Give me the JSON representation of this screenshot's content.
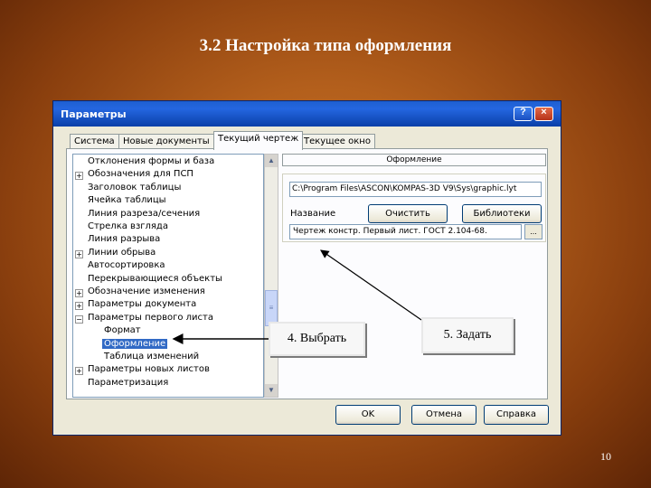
{
  "slide": {
    "title": "3.2 Настройка типа оформления",
    "number": "10"
  },
  "dialog": {
    "title": "Параметры",
    "titlebar_buttons": [
      "?",
      "×"
    ],
    "tabs": [
      "Система",
      "Новые документы",
      "Текущий чертеж",
      "Текущее окно"
    ],
    "active_tab": "Текущий чертеж",
    "tree": [
      {
        "label": "Отклонения формы и база",
        "expander": "",
        "indent": 0
      },
      {
        "label": "Обозначения для ПСП",
        "expander": "+",
        "indent": 0
      },
      {
        "label": "Заголовок таблицы",
        "expander": "",
        "indent": 0
      },
      {
        "label": "Ячейка таблицы",
        "expander": "",
        "indent": 0
      },
      {
        "label": "Линия разреза/сечения",
        "expander": "",
        "indent": 0
      },
      {
        "label": "Стрелка взгляда",
        "expander": "",
        "indent": 0
      },
      {
        "label": "Линия разрыва",
        "expander": "",
        "indent": 0
      },
      {
        "label": "Линии обрыва",
        "expander": "+",
        "indent": 0
      },
      {
        "label": "Автосортировка",
        "expander": "",
        "indent": 0
      },
      {
        "label": "Перекрывающиеся объекты",
        "expander": "",
        "indent": 0
      },
      {
        "label": "Обозначение изменения",
        "expander": "+",
        "indent": 0
      },
      {
        "label": "Параметры документа",
        "expander": "+",
        "indent": 0
      },
      {
        "label": "Параметры первого листа",
        "expander": "−",
        "indent": 0
      },
      {
        "label": "Формат",
        "expander": "",
        "indent": 1
      },
      {
        "label": "Оформление",
        "expander": "",
        "indent": 1,
        "selected": true
      },
      {
        "label": "Таблица изменений",
        "expander": "",
        "indent": 1
      },
      {
        "label": "Параметры новых листов",
        "expander": "+",
        "indent": 0
      },
      {
        "label": "Параметризация",
        "expander": "",
        "indent": 0
      }
    ],
    "scrollbar": {
      "up": "▲",
      "down": "▼",
      "grip": "≡"
    },
    "right_panel": {
      "header": "Оформление",
      "path": "C:\\Program Files\\ASCON\\KOMPAS-3D V9\\Sys\\graphic.lyt",
      "name_label": "Название",
      "clear_button": "Очистить",
      "libraries_button": "Библиотеки",
      "name_value": "Чертеж констр. Первый лист. ГОСТ 2.104-68.",
      "ellipsis_button": "..."
    },
    "buttons": {
      "ok": "OK",
      "cancel": "Отмена",
      "help": "Справка"
    }
  },
  "annotations": {
    "select": "4. Выбрать",
    "set": "5. Задать"
  }
}
